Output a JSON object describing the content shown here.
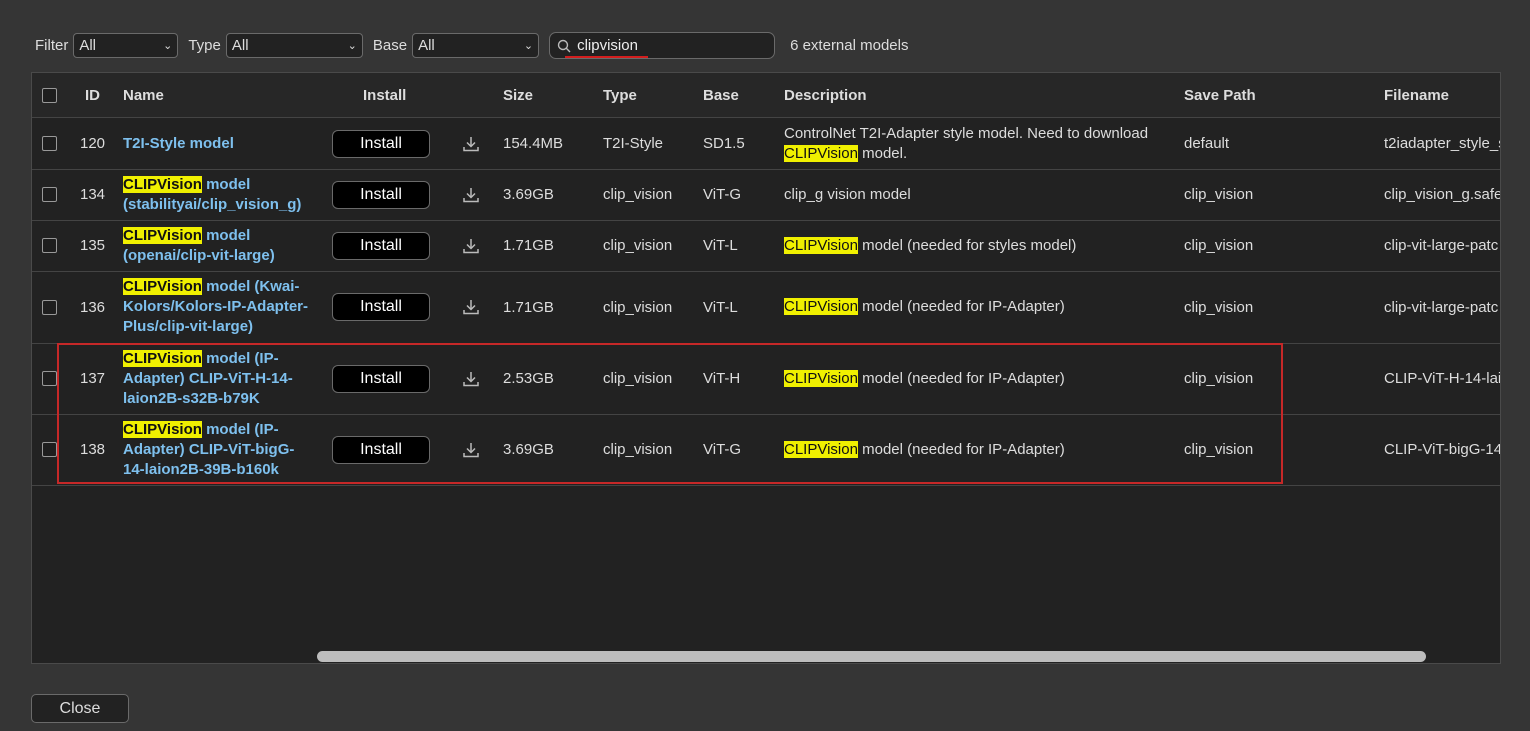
{
  "filters": {
    "filter_label": "Filter",
    "filter_value": "All",
    "type_label": "Type",
    "type_value": "All",
    "base_label": "Base",
    "base_value": "All",
    "search_value": "clipvision",
    "count_text": "6 external models"
  },
  "table": {
    "headers": {
      "id": "ID",
      "name": "Name",
      "install": "Install",
      "size": "Size",
      "type": "Type",
      "base": "Base",
      "description": "Description",
      "save_path": "Save Path",
      "filename": "Filename"
    },
    "install_label": "Install",
    "highlight": "CLIPVision",
    "rows": [
      {
        "id": "120",
        "name_hl": "",
        "name_rest": "T2I-Style model",
        "size": "154.4MB",
        "type": "T2I-Style",
        "base": "SD1.5",
        "desc_pre": "ControlNet T2I-Adapter style model. Need to download ",
        "desc_hl": "CLIPVision",
        "desc_post": " model.",
        "save_path": "default",
        "filename": "t2iadapter_style_s"
      },
      {
        "id": "134",
        "name_hl": "CLIPVision",
        "name_rest": " model (stabilityai/clip_vision_g)",
        "size": "3.69GB",
        "type": "clip_vision",
        "base": "ViT-G",
        "desc_pre": "clip_g vision model",
        "desc_hl": "",
        "desc_post": "",
        "save_path": "clip_vision",
        "filename": "clip_vision_g.safet"
      },
      {
        "id": "135",
        "name_hl": "CLIPVision",
        "name_rest": " model (openai/clip-vit-large)",
        "size": "1.71GB",
        "type": "clip_vision",
        "base": "ViT-L",
        "desc_pre": "",
        "desc_hl": "CLIPVision",
        "desc_post": " model (needed for styles model)",
        "save_path": "clip_vision",
        "filename": "clip-vit-large-patc"
      },
      {
        "id": "136",
        "name_hl": "CLIPVision",
        "name_rest": " model (Kwai-Kolors/Kolors-IP-Adapter-Plus/clip-vit-large)",
        "size": "1.71GB",
        "type": "clip_vision",
        "base": "ViT-L",
        "desc_pre": "",
        "desc_hl": "CLIPVision",
        "desc_post": " model (needed for IP-Adapter)",
        "save_path": "clip_vision",
        "filename": "clip-vit-large-patc"
      },
      {
        "id": "137",
        "name_hl": "CLIPVision",
        "name_rest": " model (IP-Adapter) CLIP-ViT-H-14-laion2B-s32B-b79K",
        "size": "2.53GB",
        "type": "clip_vision",
        "base": "ViT-H",
        "desc_pre": "",
        "desc_hl": "CLIPVision",
        "desc_post": " model (needed for IP-Adapter)",
        "save_path": "clip_vision",
        "filename": "CLIP-ViT-H-14-lai"
      },
      {
        "id": "138",
        "name_hl": "CLIPVision",
        "name_rest": " model (IP-Adapter) CLIP-ViT-bigG-14-laion2B-39B-b160k",
        "size": "3.69GB",
        "type": "clip_vision",
        "base": "ViT-G",
        "desc_pre": "",
        "desc_hl": "CLIPVision",
        "desc_post": " model (needed for IP-Adapter)",
        "save_path": "clip_vision",
        "filename": "CLIP-ViT-bigG-14-"
      }
    ]
  },
  "footer": {
    "close_label": "Close"
  }
}
